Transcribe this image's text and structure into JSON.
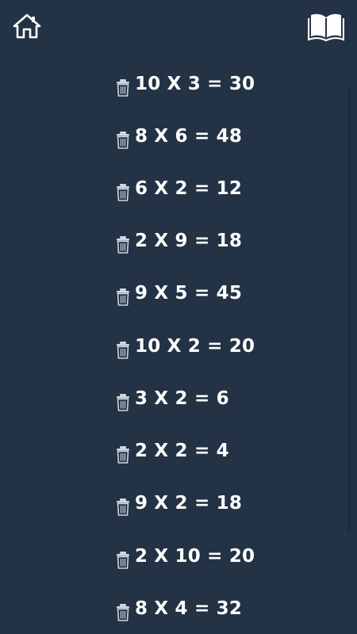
{
  "header": {
    "home_icon": "home-icon",
    "book_icon": "open-book-icon"
  },
  "items": [
    {
      "expression": "10 X 3 = 30"
    },
    {
      "expression": "8 X 6 = 48"
    },
    {
      "expression": "6 X 2 = 12"
    },
    {
      "expression": "2 X 9 = 18"
    },
    {
      "expression": "9 X 5 = 45"
    },
    {
      "expression": "10 X 2 = 20"
    },
    {
      "expression": "3 X 2 = 6"
    },
    {
      "expression": "2 X 2 = 4"
    },
    {
      "expression": "9 X 2 = 18"
    },
    {
      "expression": "2 X 10 = 20"
    },
    {
      "expression": "8 X 4 = 32"
    }
  ],
  "colors": {
    "background": "#233244",
    "text": "#ffffff",
    "icon": "#ffffff",
    "trash_icon": "#cfd6df"
  }
}
